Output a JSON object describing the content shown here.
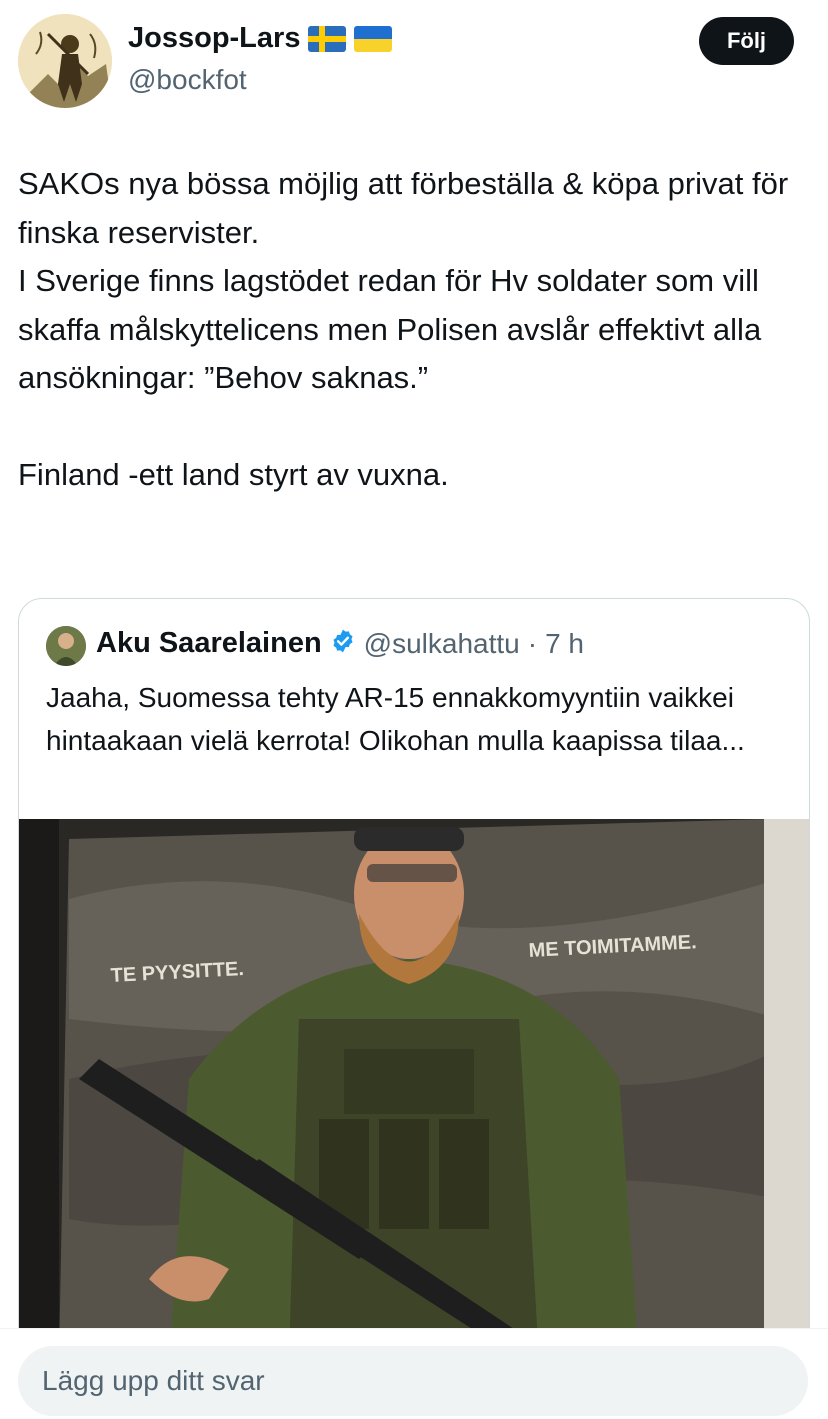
{
  "author": {
    "display_name": "Jossop-Lars",
    "handle": "@bockfot",
    "flags": [
      "sweden-flag-icon",
      "ukraine-flag-icon"
    ]
  },
  "follow_button": {
    "label": "Följ"
  },
  "tweet": {
    "lines": [
      "SAKOs nya bössa möjlig att förbeställa & köpa privat för finska reservister.",
      "I Sverige finns lagstödet redan för Hv soldater som vill skaffa målskyttelicens men Polisen avslår effektivt alla ansökningar: ”Behov saknas.”",
      "Finland -ett land styrt av vuxna."
    ]
  },
  "quoted_tweet": {
    "display_name": "Aku Saarelainen",
    "verified_icon": "verified-badge-icon",
    "handle": "@sulkahattu",
    "separator": "·",
    "time": "7 h",
    "text": "Jaaha, Suomessa tehty AR-15 ennakkomyyntiin vaikkei hintaakaan vielä kerrota! Olikohan mulla kaapissa tilaa...",
    "image": {
      "poster_text_left": "TE PYYSITTE.",
      "poster_text_right": "ME TOIMITAMME."
    }
  },
  "reply": {
    "placeholder": "Lägg upp ditt svar"
  },
  "colors": {
    "text_primary": "#0f1419",
    "text_secondary": "#536471",
    "border": "#cfd9de",
    "verified": "#1d9bf0",
    "follow_bg": "#0f1419",
    "input_bg": "#eff3f4"
  }
}
